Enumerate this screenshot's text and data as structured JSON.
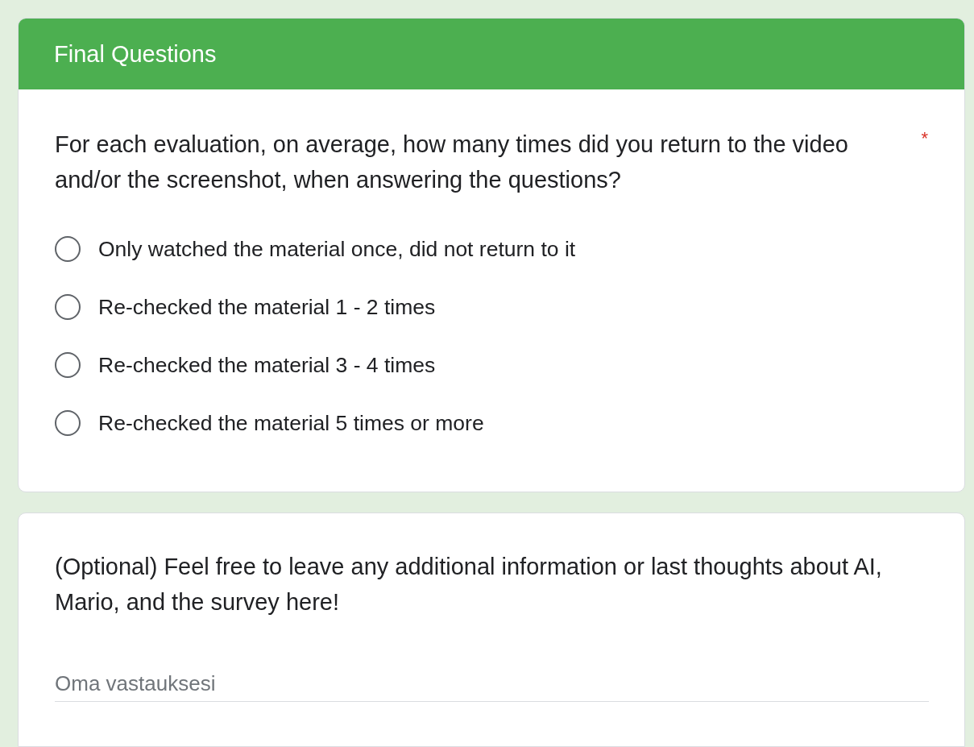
{
  "section": {
    "title": "Final Questions"
  },
  "question": {
    "text": "For each evaluation, on average, how many times did you return to the video and/or the screenshot, when answering the questions?",
    "required_mark": "*",
    "options": [
      {
        "label": "Only watched the material once, did not return to it",
        "selected": false
      },
      {
        "label": "Re-checked the material 1 - 2 times",
        "selected": false
      },
      {
        "label": "Re-checked the material 3 - 4 times",
        "selected": false
      },
      {
        "label": "Re-checked the material 5 times or more",
        "selected": false
      }
    ]
  },
  "comment": {
    "text": "(Optional) Feel free to leave any additional information or last thoughts about AI, Mario, and the survey here!",
    "placeholder": "Oma vastauksesi"
  }
}
